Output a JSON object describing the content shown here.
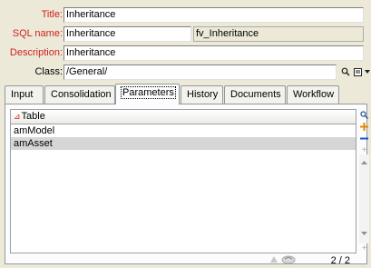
{
  "form": {
    "title_label": "Title:",
    "title_value": "Inheritance",
    "sql_label": "SQL name:",
    "sql_value": "Inheritance",
    "sql_prefixed": "fv_Inheritance",
    "description_label": "Description:",
    "description_value": "Inheritance",
    "class_label": "Class:",
    "class_value": "/General/"
  },
  "tabs": [
    {
      "label": "Input"
    },
    {
      "label": "Consolidation"
    },
    {
      "label": "Parameters"
    },
    {
      "label": "History"
    },
    {
      "label": "Documents"
    },
    {
      "label": "Workflow"
    }
  ],
  "active_tab": "Parameters",
  "grid": {
    "header": "Table",
    "rows": [
      "amModel",
      "amAsset"
    ]
  },
  "status": {
    "count": "2 / 2"
  },
  "colors": {
    "label_red": "#d21f1f",
    "background": "#ece9d8",
    "add_plus": "#e08a00",
    "remove_minus": "#1f4fd2"
  },
  "icons": [
    "search-icon",
    "list-icon",
    "dropdown-icon",
    "sort-asc-icon",
    "add-icon",
    "remove-icon",
    "scroll-up-icon",
    "scroll-down-icon",
    "filter-icon",
    "refresh-icon"
  ]
}
